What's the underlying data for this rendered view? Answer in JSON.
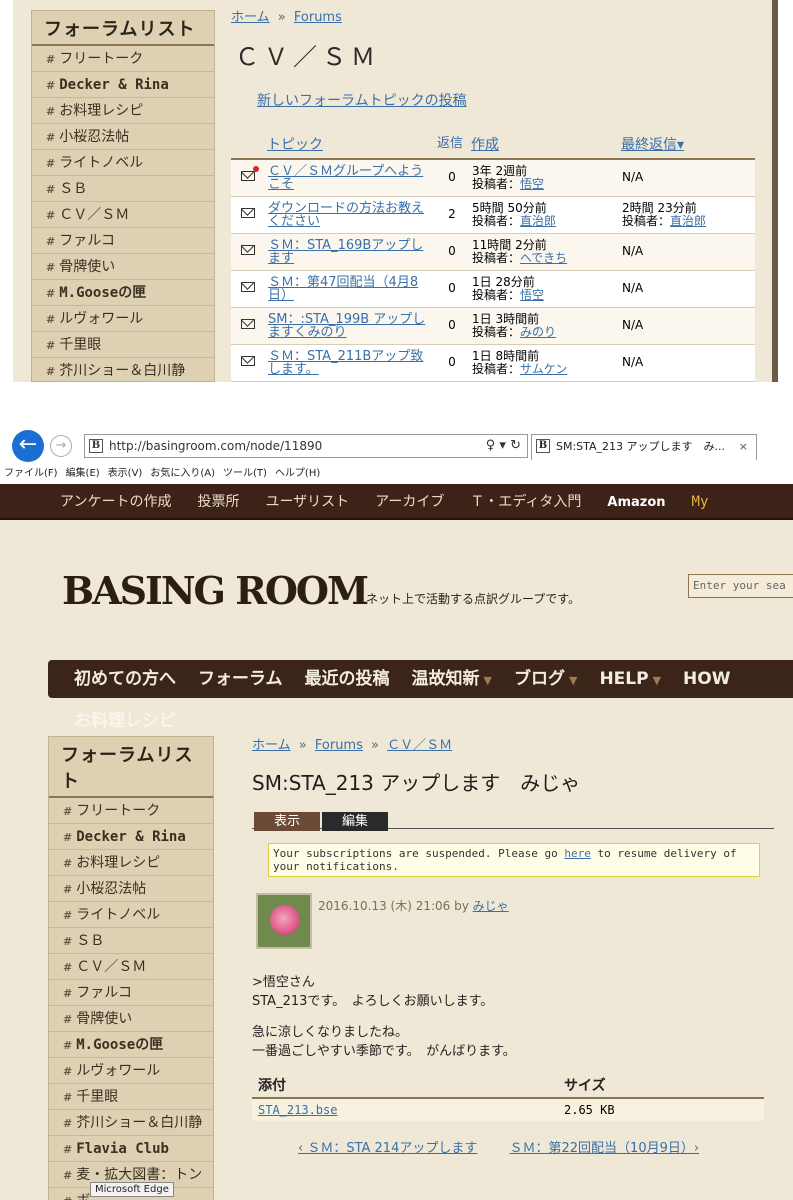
{
  "screen1": {
    "sidebar": {
      "title": "フォーラムリスト",
      "items": [
        {
          "label": "フリートーク",
          "mono": false
        },
        {
          "label": "Decker & Rina",
          "mono": true
        },
        {
          "label": "お料理レシピ",
          "mono": false
        },
        {
          "label": "小桜忍法帖",
          "mono": false
        },
        {
          "label": "ライトノベル",
          "mono": false
        },
        {
          "label": "ＳＢ",
          "mono": false
        },
        {
          "label": "ＣＶ／ＳＭ",
          "mono": false
        },
        {
          "label": "ファルコ",
          "mono": false
        },
        {
          "label": "骨牌使い",
          "mono": false
        },
        {
          "label": "M.Gooseの匣",
          "mono": true
        },
        {
          "label": "ルヴォワール",
          "mono": false
        },
        {
          "label": "千里眼",
          "mono": false
        },
        {
          "label": "芥川ショー＆白川静",
          "mono": false
        }
      ]
    },
    "breadcrumb": {
      "home": "ホーム",
      "sep": "»",
      "forums": "Forums"
    },
    "title": "ＣＶ／ＳＭ",
    "new_topic": "新しいフォーラムトピックの投稿",
    "table": {
      "headers": {
        "topic": "トピック",
        "replies": "返信",
        "created": "作成",
        "last_reply": "最終返信▾"
      },
      "rows": [
        {
          "topic": "ＣＶ／ＳＭグループへようこそ",
          "replies": "0",
          "time": "3年 2週前",
          "by": "投稿者：",
          "author": "悟空",
          "last": "N/A",
          "last_by": "",
          "last_author": "",
          "new": true
        },
        {
          "topic": "ダウンロードの方法お教えください",
          "replies": "2",
          "time": "5時間 50分前",
          "by": "投稿者：",
          "author": "直治郎",
          "last": "2時間 23分前",
          "last_by": "投稿者：",
          "last_author": "直治郎",
          "new": false
        },
        {
          "topic": "ＳＭ：STA_169Bアップします",
          "replies": "0",
          "time": "11時間 2分前",
          "by": "投稿者：",
          "author": "へできち",
          "last": "N/A",
          "last_by": "",
          "last_author": "",
          "new": false
        },
        {
          "topic": "ＳＭ：第47回配当（4月8日）",
          "replies": "0",
          "time": "1日 28分前",
          "by": "投稿者：",
          "author": "悟空",
          "last": "N/A",
          "last_by": "",
          "last_author": "",
          "new": false
        },
        {
          "topic": "SM：:STA_199B アップしますくみのり",
          "replies": "0",
          "time": "1日 3時間前",
          "by": "投稿者：",
          "author": "みのり",
          "last": "N/A",
          "last_by": "",
          "last_author": "",
          "new": false
        },
        {
          "topic": "ＳＭ：STA_211Bアップ致します。",
          "replies": "0",
          "time": "1日 8時間前",
          "by": "投稿者：",
          "author": "サムケン",
          "last": "N/A",
          "last_by": "",
          "last_author": "",
          "new": false
        }
      ]
    }
  },
  "browser": {
    "url": "http://basingroom.com/node/11890",
    "favicon": "B",
    "url_icons": "♀ ▾ ↻",
    "tab_title": "SM:STA_213 アップします　み...",
    "tab_close": "×",
    "menu": [
      "ファイル(F)",
      "編集(E)",
      "表示(V)",
      "お気に入り(A)",
      "ツール(T)",
      "ヘルプ(H)"
    ]
  },
  "screen2": {
    "topnav": [
      "アンケートの作成",
      "投票所",
      "ユーザリスト",
      "アーカイブ",
      "Ｔ・エディタ入門"
    ],
    "topnav_amazon": "Amazon",
    "topnav_my": "My",
    "logo": "BASING ROOM",
    "tagline": "ネット上で活動する点訳グループです。",
    "search_placeholder": "Enter your sea",
    "mainnav": [
      {
        "label": "初めての方へ",
        "caret": ""
      },
      {
        "label": "フォーラム",
        "caret": ""
      },
      {
        "label": "最近の投稿",
        "caret": ""
      },
      {
        "label": "温故知新",
        "caret": "▼"
      },
      {
        "label": "ブログ",
        "caret": "▼"
      },
      {
        "label": "HELP",
        "caret": "▼"
      },
      {
        "label": "HOW",
        "caret": ""
      }
    ],
    "ghost_label": "お料理レシピ",
    "sidebar": {
      "title": "フォーラムリスト",
      "items": [
        {
          "label": "フリートーク",
          "mono": false
        },
        {
          "label": "Decker & Rina",
          "mono": true
        },
        {
          "label": "お料理レシピ",
          "mono": false
        },
        {
          "label": "小桜忍法帖",
          "mono": false
        },
        {
          "label": "ライトノベル",
          "mono": false
        },
        {
          "label": "ＳＢ",
          "mono": false
        },
        {
          "label": "ＣＶ／ＳＭ",
          "mono": false
        },
        {
          "label": "ファルコ",
          "mono": false
        },
        {
          "label": "骨牌使い",
          "mono": false
        },
        {
          "label": "M.Gooseの匣",
          "mono": true
        },
        {
          "label": "ルヴォワール",
          "mono": false
        },
        {
          "label": "千里眼",
          "mono": false
        },
        {
          "label": "芥川ショー＆白川静",
          "mono": false
        },
        {
          "label": "Flavia Club",
          "mono": true
        },
        {
          "label": "麦・拡大図書：トン",
          "mono": false
        },
        {
          "label": "ボ",
          "mono": false
        }
      ]
    },
    "breadcrumb": {
      "home": "ホーム",
      "sep": "»",
      "forums": "Forums",
      "current": "ＣＶ／ＳＭ"
    },
    "title": "SM:STA_213 アップします　みじゃ",
    "tabs": {
      "view": "表示",
      "edit": "編集"
    },
    "notice_pre": "Your subscriptions are suspended. Please go ",
    "notice_link": "here",
    "notice_post": " to resume delivery of your notifications.",
    "meta_date": "2016.10.13 (木) 21:06 by ",
    "meta_author": "みじゃ",
    "body": [
      ">悟空さん",
      "STA_213です。　よろしくお願いします。",
      "急に涼しくなりましたね。",
      "一番過ごしやすい季節です。　がんばります。"
    ],
    "attachments": {
      "headers": {
        "file": "添付",
        "size": "サイズ"
      },
      "rows": [
        {
          "file": "STA_213.bse",
          "size": "2.65 KB"
        }
      ]
    },
    "pager": {
      "prev": "‹ ＳＭ：STA 214アップします",
      "next": "ＳＭ：第22回配当（10月9日）›"
    },
    "tooltip": "Microsoft Edge"
  },
  "colors": {
    "nav_dark": "#3b2418",
    "sidebar_bg": "#ddd0b3",
    "link": "#3a6fa8",
    "page_bg": "#efe8d6"
  }
}
